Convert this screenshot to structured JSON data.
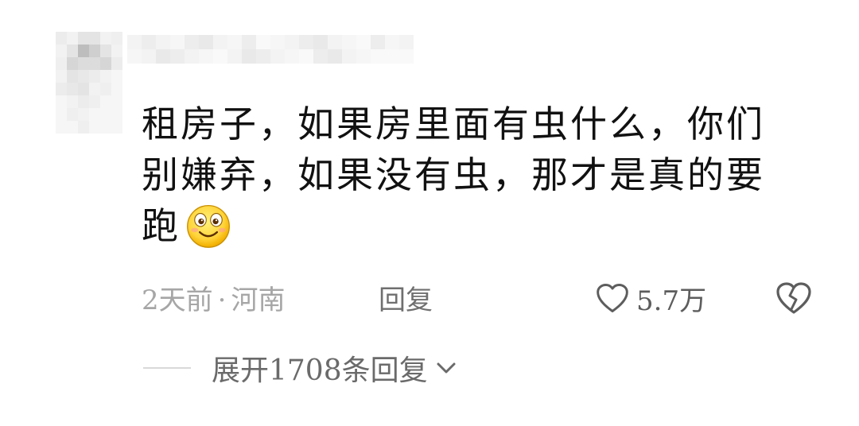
{
  "comment": {
    "author_name_redacted": true,
    "avatar_redacted": true,
    "lines": [
      "租房子，如果房里面有虫什么，你们",
      "别嫌弃，如果没有虫，那才是真的要",
      "跑"
    ],
    "emoji": "smile-emoji"
  },
  "meta": {
    "time": "2天前",
    "separator": "·",
    "location": "河南",
    "reply_label": "回复"
  },
  "actions": {
    "like_icon": "heart-outline-icon",
    "like_count": "5.7万",
    "dislike_icon": "broken-heart-icon"
  },
  "replies": {
    "expand_label": "展开1708条回复",
    "expand_icon": "chevron-down-icon"
  },
  "colors": {
    "text": "#111111",
    "meta": "#a6a6a6",
    "action": "#5d5d5d",
    "emoji_face": "#ffd43b"
  }
}
